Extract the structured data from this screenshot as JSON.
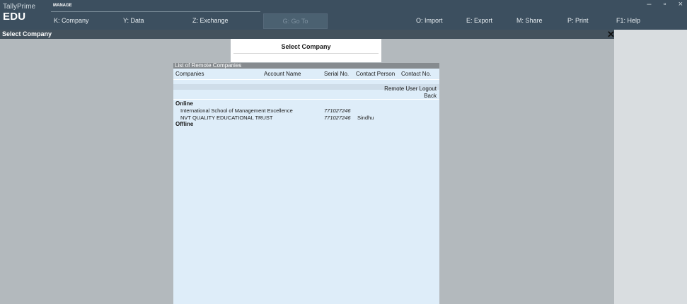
{
  "app": {
    "brand_small": "TallyPrime",
    "brand_big": "EDU",
    "manage_label": "MANAGE"
  },
  "menu": [
    {
      "key": "K",
      "label": "K: Company"
    },
    {
      "key": "Y",
      "label": "Y: Data"
    },
    {
      "key": "Z",
      "label": "Z: Exchange"
    },
    {
      "key": "G",
      "label": "G: Go To"
    },
    {
      "key": "O",
      "label": "O: Import"
    },
    {
      "key": "E",
      "label": "E: Export"
    },
    {
      "key": "M",
      "label": "M: Share"
    },
    {
      "key": "P",
      "label": "P: Print"
    },
    {
      "key": "F1",
      "label": "F1: Help"
    }
  ],
  "window_controls": {
    "minimize": "–",
    "restore": "▫",
    "close": "×"
  },
  "title_strip": "Select Company",
  "close_glyph": "✕",
  "select_popup": {
    "title": "Select Company"
  },
  "remote_list": {
    "header": "List of Remote Companies",
    "columns": {
      "companies": "Companies",
      "account_name": "Account Name",
      "serial_no": "Serial No.",
      "contact_person": "Contact Person",
      "contact_no": "Contact No."
    },
    "remote_user_logout": "Remote User Logout",
    "back": "Back",
    "online_label": "Online",
    "offline_label": "Offline",
    "rows": [
      {
        "name": "International School of Management Excellence",
        "serial": "771027246",
        "person": ""
      },
      {
        "name": "NVT QUALITY EDUCATIONAL TRUST",
        "serial": "771027246",
        "person": "Sindhu"
      }
    ]
  }
}
